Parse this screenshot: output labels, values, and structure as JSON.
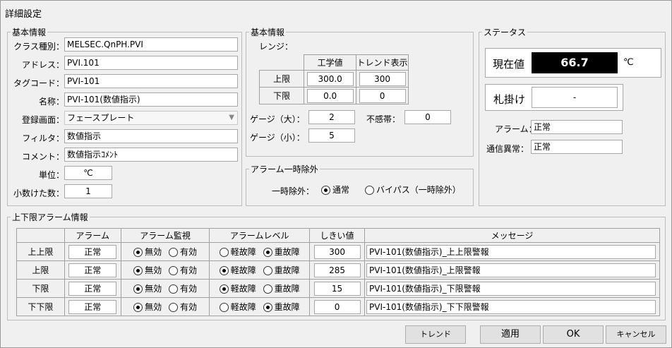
{
  "window": {
    "title": "詳細設定"
  },
  "basic": {
    "legend": "基本情報",
    "class_label": "クラス種別：",
    "class_value": "MELSEC.QnPH.PVI",
    "address_label": "アドレス：",
    "address_value": "PVI.101",
    "tagcode_label": "タグコード：",
    "tagcode_value": "PVI-101",
    "name_label": "名称：",
    "name_value": "PVI-101(数値指示)",
    "screen_label": "登録画面：",
    "screen_value": "フェースプレート",
    "filter_label": "フィルタ：",
    "filter_value": "数値指示",
    "comment_label": "コメント：",
    "comment_value": "数値指示ｺﾒﾝﾄ",
    "unit_label": "単位：",
    "unit_value": "℃",
    "decimal_label": "小数けた数：",
    "decimal_value": "1"
  },
  "range": {
    "legend": "基本情報",
    "range_label": "レンジ：",
    "col_eng": "工学値",
    "col_trend": "トレンド表示",
    "upper_label": "上限",
    "upper_eng": "300.0",
    "upper_trend": "300",
    "lower_label": "下限",
    "lower_eng": "0.0",
    "lower_trend": "0",
    "gauge_large_label": "ゲージ（大）：",
    "gauge_large_value": "2",
    "gauge_small_label": "ゲージ（小）：",
    "gauge_small_value": "5",
    "deadband_label": "不感帯：",
    "deadband_value": "0"
  },
  "alarm_exclude": {
    "legend": "アラーム一時除外",
    "label": "一時除外：",
    "opt_normal": "通常",
    "opt_bypass": "バイパス（一時除外）",
    "selected": "通常"
  },
  "status": {
    "legend": "ステータス",
    "current_label": "現在値",
    "current_value": "66.7",
    "current_unit": "℃",
    "tag_label": "札掛け",
    "tag_value": "-",
    "alarm_label": "アラーム：",
    "alarm_value": "正常",
    "comm_label": "通信異常：",
    "comm_value": "正常"
  },
  "limits": {
    "legend": "上下限アラーム情報",
    "headers": [
      "",
      "アラーム",
      "アラーム監視",
      "アラームレベル",
      "しきい値",
      "メッセージ"
    ],
    "monitor_options": [
      "無効",
      "有効"
    ],
    "level_options": [
      "軽故障",
      "重故障"
    ],
    "rows": [
      {
        "name": "上上限",
        "alarm": "正常",
        "monitor": "無効",
        "level": "重故障",
        "threshold": "300",
        "message": "PVI-101(数値指示)_上上限警報"
      },
      {
        "name": "上限",
        "alarm": "正常",
        "monitor": "無効",
        "level": "軽故障",
        "threshold": "285",
        "message": "PVI-101(数値指示)_上限警報"
      },
      {
        "name": "下限",
        "alarm": "正常",
        "monitor": "無効",
        "level": "軽故障",
        "threshold": "15",
        "message": "PVI-101(数値指示)_下限警報"
      },
      {
        "name": "下下限",
        "alarm": "正常",
        "monitor": "無効",
        "level": "重故障",
        "threshold": "0",
        "message": "PVI-101(数値指示)_下下限警報"
      }
    ]
  },
  "buttons": {
    "trend": "トレンド",
    "apply": "適用",
    "ok": "OK",
    "cancel": "キャンセル"
  },
  "colors": {
    "current_value_bg": "#000000",
    "current_value_fg": "#ffffff"
  }
}
